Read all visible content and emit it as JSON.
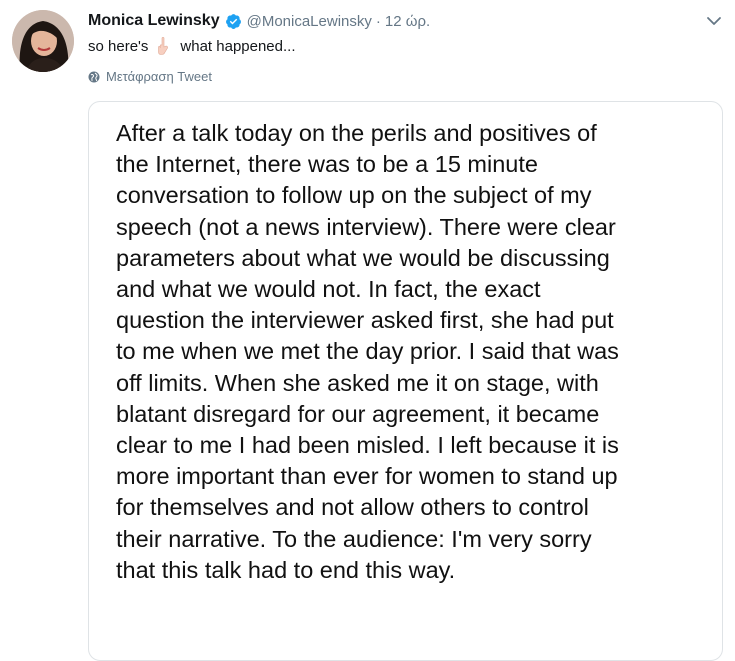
{
  "tweet": {
    "author_name": "Monica Lewinsky",
    "handle": "@MonicaLewinsky",
    "separator": "·",
    "time": "12 ώρ.",
    "text_before_emoji": "so here's",
    "text_after_emoji": "what happened...",
    "emoji_icon": "backhand-index-pointing-down",
    "translate_label": "Μετάφραση Tweet",
    "verified_color": "#1da1f2"
  },
  "statement": {
    "lines": [
      "After a talk today on the perils and positives of",
      "the Internet, there was to be a 15 minute",
      "conversation to follow up on the subject of my",
      "speech (not a news interview). There were clear",
      "parameters about what we would be discussing",
      "and what we would not. In fact, the exact",
      "question the interviewer asked first, she had put",
      "to me when we met the day prior. I said that was",
      "off limits. When she asked me it on stage, with",
      "blatant disregard for our agreement, it became",
      "clear to me I had been misled. I left because it is",
      "more important than ever for women to stand up",
      "for themselves and not allow others to control",
      "their narrative. To the audience: I'm very sorry",
      "that this talk had to end this way."
    ]
  }
}
